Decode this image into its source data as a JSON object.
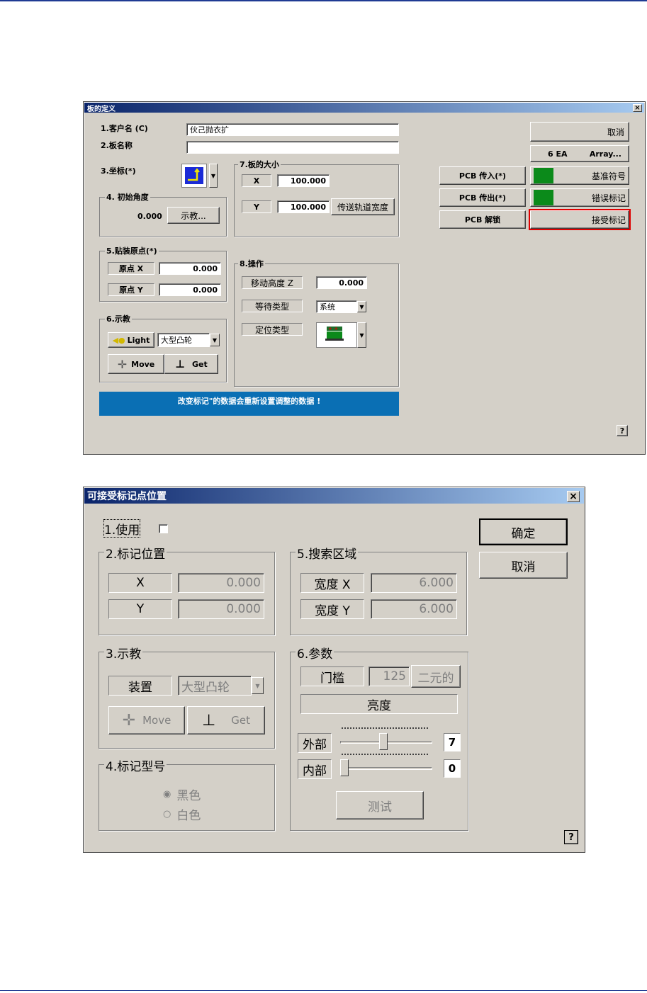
{
  "board_dialog": {
    "title": "板的定义",
    "close": "×",
    "customer_label": "1.客户名 (C)",
    "customer_value": "伙己抛衣扩",
    "board_name_label": "2.板名称",
    "board_name_value": "",
    "coord_label": "3.坐标(*)",
    "angle_group": "4. 初始角度",
    "angle_value": "0.000",
    "teach_btn": "示教...",
    "origin_group": "5.贴装原点(*)",
    "origin_x_label": "原点 X",
    "origin_x_value": "0.000",
    "origin_y_label": "原点 Y",
    "origin_y_value": "0.000",
    "teach_group": "6.示教",
    "light_btn": "Light",
    "camera_select": "大型凸轮",
    "move_btn": "Move",
    "get_btn": "Get",
    "size_group": "7.板的大小",
    "size_x_label": "X",
    "size_x_value": "100.000",
    "size_y_label": "Y",
    "size_y_value": "100.000",
    "conveyor_btn": "传送轨道宽度",
    "op_group": "8.操作",
    "move_height_label": "移动高度 Z",
    "move_height_value": "0.000",
    "wait_type_label": "等待类型",
    "wait_type_value": "系统",
    "pos_type_label": "定位类型",
    "cancel_btn": "取消",
    "array_count": "6 EA",
    "array_btn": "Array...",
    "pcb_in_btn": "PCB 传入(*)",
    "pcb_out_btn": "PCB 传出(*)",
    "pcb_unlock_btn": "PCB 解锁",
    "fiducial_btn": "基准符号",
    "bad_mark_btn": "错误标记",
    "accept_mark_btn": "接受标记",
    "status_message": "改变标记\"的数据会重新设置调整的数据 !",
    "help": "?",
    "colors": {
      "status_bg": "#0a6fb4",
      "indicator": "#0b8a1a",
      "highlight": "#e00000"
    }
  },
  "accept_dialog": {
    "title": "可接受标记点位置",
    "close": "×",
    "use_label": "1.使用",
    "ok_btn": "确定",
    "cancel_btn": "取消",
    "mark_pos_group": "2.标记位置",
    "x_label": "X",
    "x_value": "0.000",
    "y_label": "Y",
    "y_value": "0.000",
    "search_group": "5.搜索区域",
    "width_x_label": "宽度 X",
    "width_x_value": "6.000",
    "width_y_label": "宽度 Y",
    "width_y_value": "6.000",
    "teach_group": "3.示教",
    "device_label": "装置",
    "device_value": "大型凸轮",
    "move_btn": "Move",
    "get_btn": "Get",
    "param_group": "6.参数",
    "threshold_label": "门槛",
    "threshold_value": "125",
    "binary_btn": "二元的",
    "brightness_label": "亮度",
    "outer_label": "外部",
    "outer_value": "7",
    "outer_level": 0.47,
    "inner_label": "内部",
    "inner_value": "0",
    "inner_level": 0.0,
    "test_btn": "测试",
    "type_group": "4.标记型号",
    "black_label": "黑色",
    "white_label": "白色",
    "help": "?"
  }
}
